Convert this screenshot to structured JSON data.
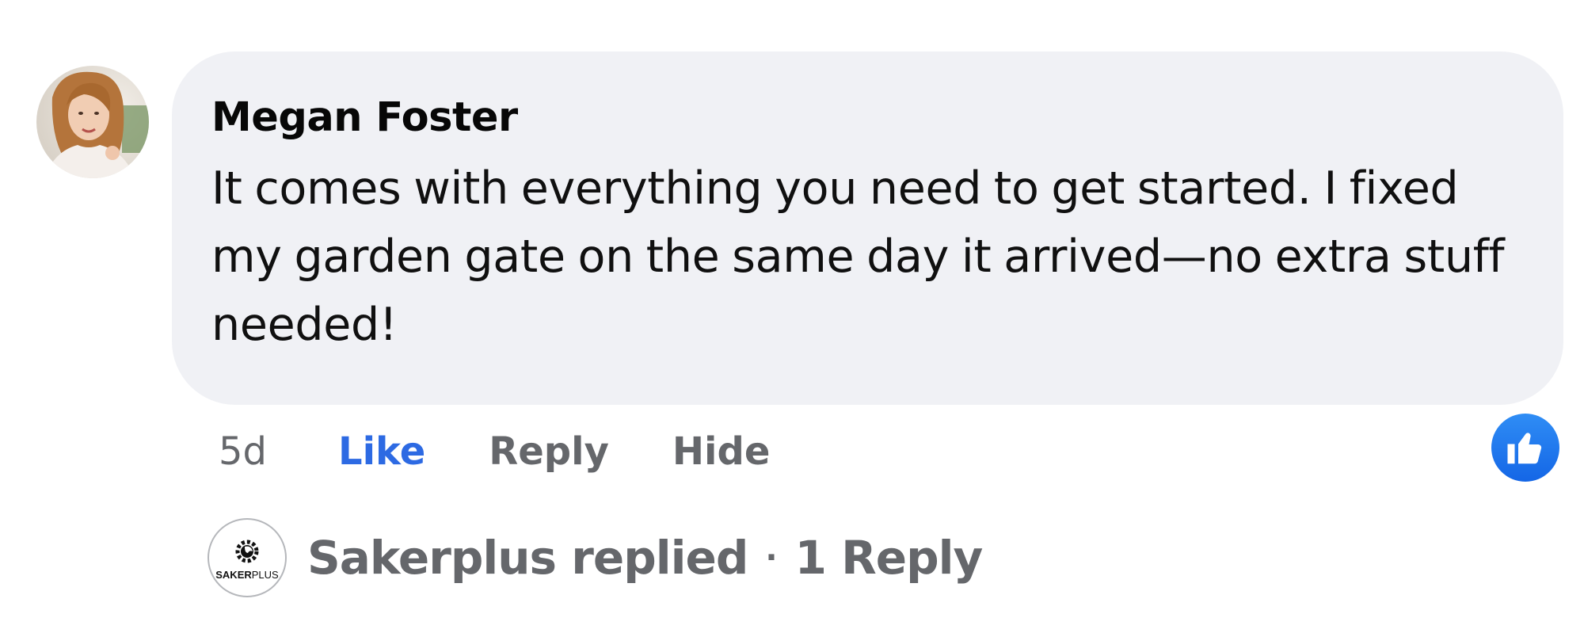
{
  "comment": {
    "author": "Megan Foster",
    "text": "It comes with everything you need to get started. I fixed my garden gate on the same day it arrived—no extra stuff needed!",
    "time": "5d",
    "actions": {
      "like": "Like",
      "reply": "Reply",
      "hide": "Hide"
    },
    "reaction_icon": "thumbs-up-icon",
    "colors": {
      "bubble": "#f0f1f5",
      "like_active": "#2d6ae3",
      "muted": "#65676b",
      "reaction": "#1877f2"
    }
  },
  "reply_summary": {
    "page_logo_main": "SAKER",
    "page_logo_suffix": "PLUS",
    "replied_text": "Sakerplus replied",
    "separator": "·",
    "count_text": "1 Reply"
  }
}
